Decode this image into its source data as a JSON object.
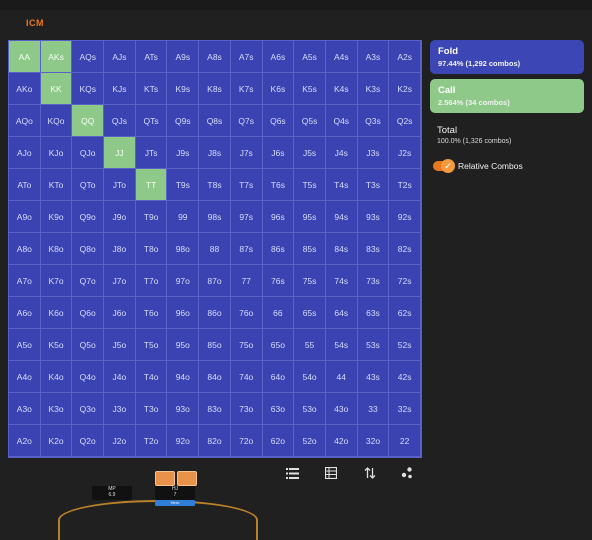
{
  "header": {
    "tab_label": "ICM"
  },
  "grid": {
    "rows": [
      [
        "AA",
        "AKs",
        "AQs",
        "AJs",
        "ATs",
        "A9s",
        "A8s",
        "A7s",
        "A6s",
        "A5s",
        "A4s",
        "A3s",
        "A2s"
      ],
      [
        "AKo",
        "KK",
        "KQs",
        "KJs",
        "KTs",
        "K9s",
        "K8s",
        "K7s",
        "K6s",
        "K5s",
        "K4s",
        "K3s",
        "K2s"
      ],
      [
        "AQo",
        "KQo",
        "QQ",
        "QJs",
        "QTs",
        "Q9s",
        "Q8s",
        "Q7s",
        "Q6s",
        "Q5s",
        "Q4s",
        "Q3s",
        "Q2s"
      ],
      [
        "AJo",
        "KJo",
        "QJo",
        "JJ",
        "JTs",
        "J9s",
        "J8s",
        "J7s",
        "J6s",
        "J5s",
        "J4s",
        "J3s",
        "J2s"
      ],
      [
        "ATo",
        "KTo",
        "QTo",
        "JTo",
        "TT",
        "T9s",
        "T8s",
        "T7s",
        "T6s",
        "T5s",
        "T4s",
        "T3s",
        "T2s"
      ],
      [
        "A9o",
        "K9o",
        "Q9o",
        "J9o",
        "T9o",
        "99",
        "98s",
        "97s",
        "96s",
        "95s",
        "94s",
        "93s",
        "92s"
      ],
      [
        "A8o",
        "K8o",
        "Q8o",
        "J8o",
        "T8o",
        "98o",
        "88",
        "87s",
        "86s",
        "85s",
        "84s",
        "83s",
        "82s"
      ],
      [
        "A7o",
        "K7o",
        "Q7o",
        "J7o",
        "T7o",
        "97o",
        "87o",
        "77",
        "76s",
        "75s",
        "74s",
        "73s",
        "72s"
      ],
      [
        "A6o",
        "K6o",
        "Q6o",
        "J6o",
        "T6o",
        "96o",
        "86o",
        "76o",
        "66",
        "65s",
        "64s",
        "63s",
        "62s"
      ],
      [
        "A5o",
        "K5o",
        "Q5o",
        "J5o",
        "T5o",
        "95o",
        "85o",
        "75o",
        "65o",
        "55",
        "54s",
        "53s",
        "52s"
      ],
      [
        "A4o",
        "K4o",
        "Q4o",
        "J4o",
        "T4o",
        "94o",
        "84o",
        "74o",
        "64o",
        "54o",
        "44",
        "43s",
        "42s"
      ],
      [
        "A3o",
        "K3o",
        "Q3o",
        "J3o",
        "T3o",
        "93o",
        "83o",
        "73o",
        "63o",
        "53o",
        "43o",
        "33",
        "32s"
      ],
      [
        "A2o",
        "K2o",
        "Q2o",
        "J2o",
        "T2o",
        "92o",
        "82o",
        "72o",
        "62o",
        "52o",
        "42o",
        "32o",
        "22"
      ]
    ],
    "call_hands": [
      "AA",
      "AKs",
      "KK",
      "QQ",
      "JJ",
      "TT"
    ]
  },
  "actions": {
    "fold": {
      "label": "Fold",
      "detail": "97.44% (1,292 combos)",
      "color": "#3d46b5"
    },
    "call": {
      "label": "Call",
      "detail": "2.564% (34 combos)",
      "color": "#8fc98a"
    }
  },
  "total": {
    "label": "Total",
    "detail": "100.0% (1,326 combos)"
  },
  "toggle": {
    "label": "Relative Combos",
    "on": true
  },
  "toolbar": {
    "icons": [
      "list-icon",
      "table-icon",
      "sort-icon",
      "scatter-icon"
    ]
  },
  "table": {
    "seat_mp": {
      "position": "MP",
      "stack": "6.9"
    },
    "seat_hj": {
      "position": "HJ",
      "stack": "7",
      "tag": "Hero"
    }
  }
}
